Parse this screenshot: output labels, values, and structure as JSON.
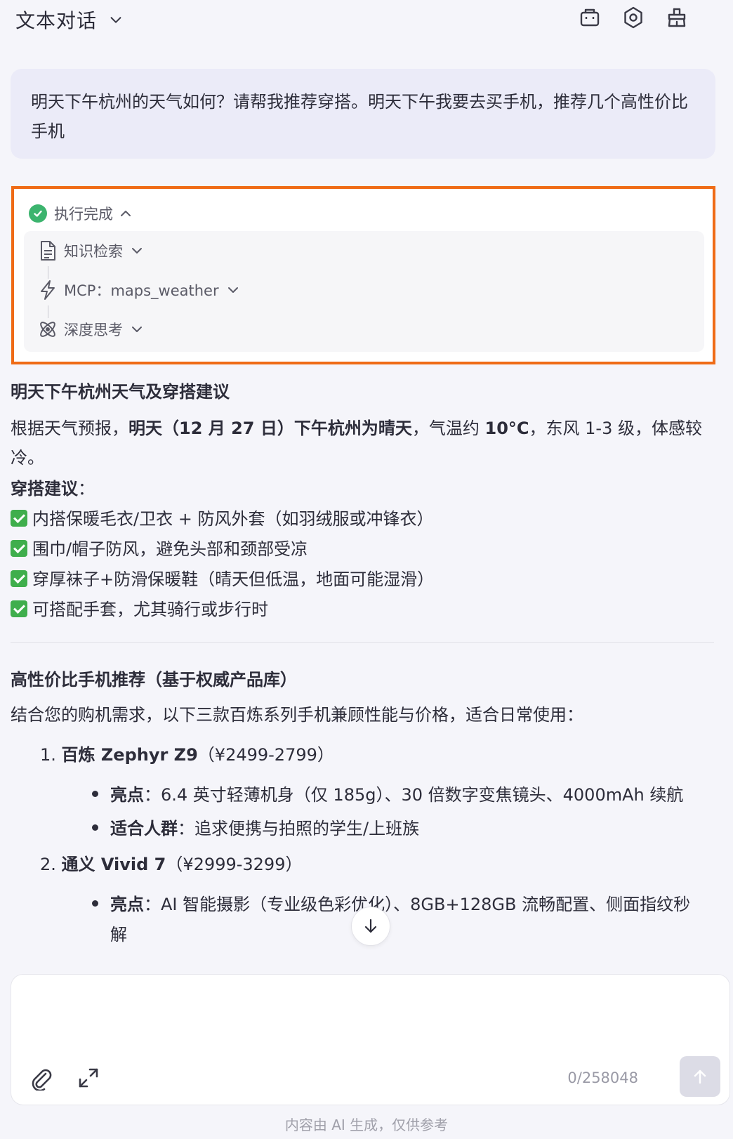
{
  "header": {
    "title": "文本对话",
    "icons": [
      "chevron-down-icon",
      "briefcase-icon",
      "gear-icon",
      "clear-icon"
    ]
  },
  "user_message": "明天下午杭州的天气如何？请帮我推荐穿搭。明天下午我要去买手机，推荐几个高性价比手机",
  "status": {
    "label": "执行完成",
    "steps": [
      {
        "label": "知识检索",
        "icon": "document-icon"
      },
      {
        "label": "MCP：maps_weather",
        "icon": "lightning-icon"
      },
      {
        "label": "深度思考",
        "icon": "atom-icon"
      }
    ]
  },
  "answer": {
    "weather_heading": "明天下午杭州天气及穿搭建议",
    "weather_prefix": "根据天气预报，",
    "weather_bold1": "明天（12 月 27 日）下午杭州为晴天",
    "weather_mid": "，气温约 ",
    "weather_bold2": "10°C",
    "weather_suffix": "，东风 1-3 级，体感较冷。",
    "outfit_heading": "穿搭建议",
    "outfit_colon": "：",
    "outfit_items": [
      "内搭保暖毛衣/卫衣 + 防风外套（如羽绒服或冲锋衣）",
      "围巾/帽子防风，避免头部和颈部受凉",
      "穿厚袜子+防滑保暖鞋（晴天但低温，地面可能湿滑）",
      "可搭配手套，尤其骑行或步行时"
    ],
    "phone_heading": "高性价比手机推荐（基于权威产品库）",
    "phone_intro": "结合您的购机需求，以下三款百炼系列手机兼顾性能与价格，适合日常使用：",
    "phones": [
      {
        "index": "1.",
        "name": "百炼 Zephyr Z9",
        "price": "（¥2499-2799）",
        "points": [
          {
            "key": "亮点",
            "text": "：6.4 英寸轻薄机身（仅 185g）、30 倍数字变焦镜头、4000mAh 续航"
          },
          {
            "key": "适合人群",
            "text": "：追求便携与拍照的学生/上班族"
          }
        ]
      },
      {
        "index": "2.",
        "name": "通义 Vivid 7",
        "price": "（¥2999-3299）",
        "points": [
          {
            "key": "亮点",
            "text": "：AI 智能摄影（专业级色彩优化）、8GB+128GB 流畅配置、侧面指纹秒",
            "cont": "解"
          }
        ]
      }
    ]
  },
  "input": {
    "placeholder": "",
    "counter": "0/258048"
  },
  "footer_note": "内容由 AI 生成，仅供参考",
  "colors": {
    "accent_border": "#ef6b16",
    "success": "#3cb46e",
    "bubble": "#ebebf8"
  }
}
